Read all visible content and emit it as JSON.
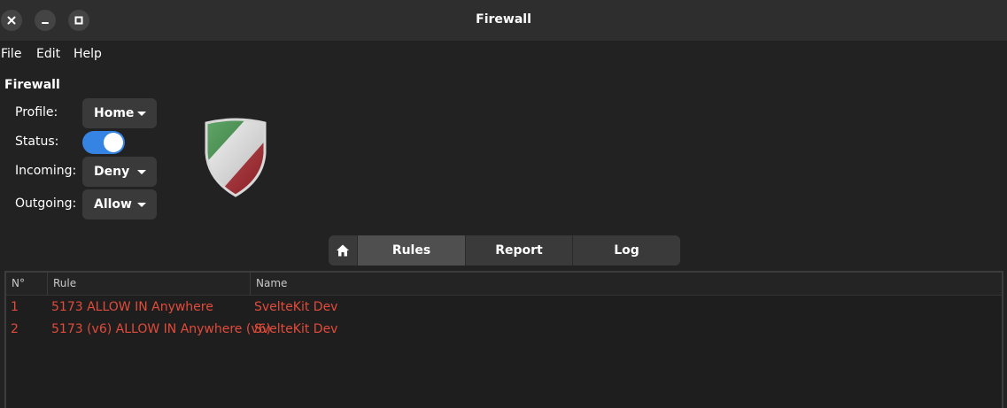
{
  "window": {
    "title": "Firewall"
  },
  "menu": [
    "File",
    "Edit",
    "Help"
  ],
  "section_title": "Firewall",
  "fields": {
    "profile": {
      "label": "Profile:",
      "value": "Home"
    },
    "status": {
      "label": "Status:",
      "enabled": true
    },
    "incoming": {
      "label": "Incoming:",
      "value": "Deny"
    },
    "outgoing": {
      "label": "Outgoing:",
      "value": "Allow"
    }
  },
  "tabs": {
    "rules": "Rules",
    "report": "Report",
    "log": "Log",
    "active": "Rules"
  },
  "table": {
    "headers": [
      "N°",
      "Rule",
      "Name"
    ],
    "rows": [
      {
        "num": "1",
        "rule": "5173 ALLOW IN Anywhere",
        "name": "SvelteKit Dev"
      },
      {
        "num": "2",
        "rule": "5173 (v6) ALLOW IN Anywhere (v6)",
        "name": "SvelteKit Dev"
      }
    ]
  },
  "colors": {
    "accent": "#3584e4",
    "rule_text": "#e24b3a",
    "background": "#222222"
  },
  "icons": [
    "close-icon",
    "minimize-icon",
    "maximize-icon",
    "home-icon",
    "shield-logo"
  ]
}
